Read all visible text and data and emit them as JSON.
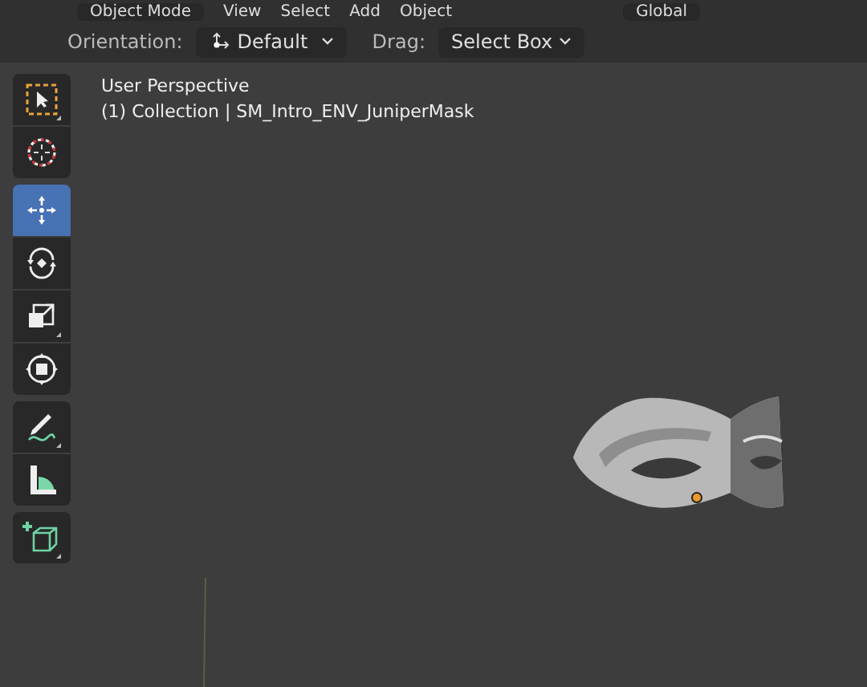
{
  "header": {
    "mode": "Object Mode",
    "menus": [
      "View",
      "Select",
      "Add",
      "Object"
    ],
    "orientation": "Global"
  },
  "tool_settings": {
    "orientation_label": "Orientation:",
    "orientation_value": "Default",
    "drag_label": "Drag:",
    "drag_value": "Select Box"
  },
  "toolbar": {
    "groups": [
      {
        "tools": [
          {
            "kind": "select",
            "selected": false
          },
          {
            "kind": "cursor",
            "selected": false
          }
        ]
      },
      {
        "tools": [
          {
            "kind": "move",
            "selected": true
          },
          {
            "kind": "rotate",
            "selected": false
          },
          {
            "kind": "scale",
            "selected": false
          },
          {
            "kind": "transform",
            "selected": false
          }
        ]
      },
      {
        "tools": [
          {
            "kind": "annotate",
            "selected": false
          },
          {
            "kind": "measure",
            "selected": false
          }
        ]
      },
      {
        "tools": [
          {
            "kind": "add-cube",
            "selected": false
          }
        ]
      }
    ]
  },
  "viewport": {
    "view_name": "User Perspective",
    "object_info": "(1) Collection | SM_Intro_ENV_JuniperMask"
  }
}
